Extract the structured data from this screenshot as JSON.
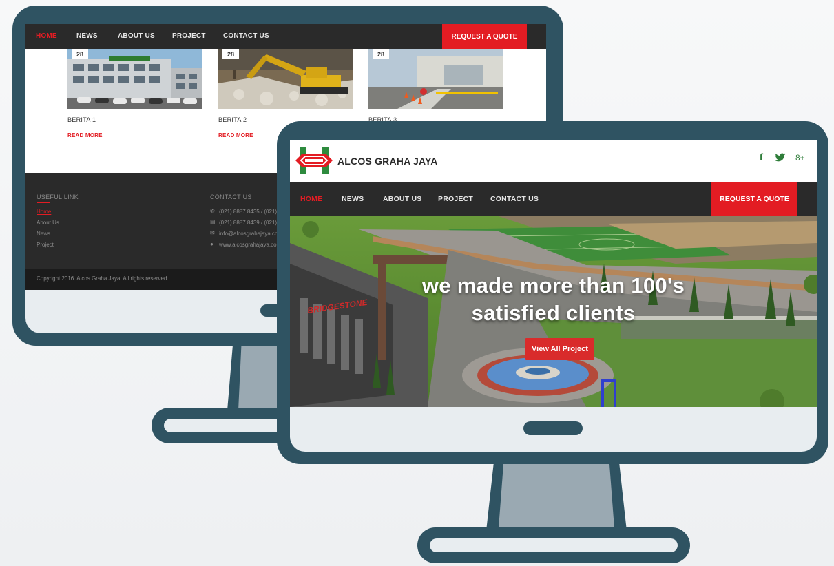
{
  "back_site": {
    "nav": {
      "items": [
        "HOME",
        "NEWS",
        "ABOUT US",
        "PROJECT",
        "CONTACT US"
      ],
      "active_index": 0,
      "quote_button": "REQUEST A QUOTE"
    },
    "news": [
      {
        "date": "28",
        "title": "BERITA 1",
        "read_more": "READ MORE"
      },
      {
        "date": "28",
        "title": "BERITA 2",
        "read_more": "READ MORE"
      },
      {
        "date": "28",
        "title": "BERITA 3",
        "read_more": ""
      }
    ],
    "footer": {
      "useful_link_heading": "USEFUL LINK",
      "links": [
        "Home",
        "About Us",
        "News",
        "Project"
      ],
      "contact_heading": "CONTACT US",
      "contacts": [
        "(021) 8887 8435 / (021) ",
        "(021) 8887 8439 / (021) ",
        "info@alcosgrahajaya.co",
        "www.alcosgrahajaya.co"
      ],
      "copyright": "Copyright 2016. Alcos Graha Jaya. All rights reserved."
    }
  },
  "front_site": {
    "brand": "ALCOS GRAHA JAYA",
    "social": {
      "facebook": "f",
      "twitter": "twitter-icon",
      "google_plus": "8+"
    },
    "nav": {
      "items": [
        "HOME",
        "NEWS",
        "ABOUT US",
        "PROJECT",
        "CONTACT US"
      ],
      "active_index": 0,
      "quote_button": "REQUEST A QUOTE"
    },
    "hero": {
      "line1": "we made more than 100's",
      "line2": "satisfied clients",
      "button": "View All Project"
    }
  },
  "colors": {
    "frame": "#2f5362",
    "accent": "#e31c23",
    "nav_bg": "#2a2a2a",
    "brand_green": "#2f7d3a"
  }
}
